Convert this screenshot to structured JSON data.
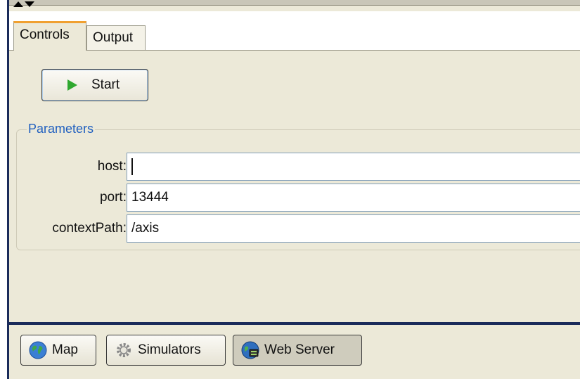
{
  "tabs": [
    {
      "label": "Controls",
      "active": true
    },
    {
      "label": "Output",
      "active": false
    }
  ],
  "controls": {
    "start_label": "Start"
  },
  "parameters": {
    "legend": "Parameters",
    "fields": [
      {
        "label": "host:",
        "value": ""
      },
      {
        "label": "port:",
        "value": "13444"
      },
      {
        "label": "contextPath:",
        "value": "/axis"
      }
    ]
  },
  "bottom_buttons": [
    {
      "label": "Map",
      "icon": "globe-icon",
      "selected": false
    },
    {
      "label": "Simulators",
      "icon": "gear-icon",
      "selected": false
    },
    {
      "label": "Web Server",
      "icon": "web-server-icon",
      "selected": true
    }
  ],
  "colors": {
    "panel_bg": "#ece9d8",
    "legend_blue": "#1f5fbf",
    "play_green": "#2fa82f",
    "tab_accent": "#f0a030"
  }
}
